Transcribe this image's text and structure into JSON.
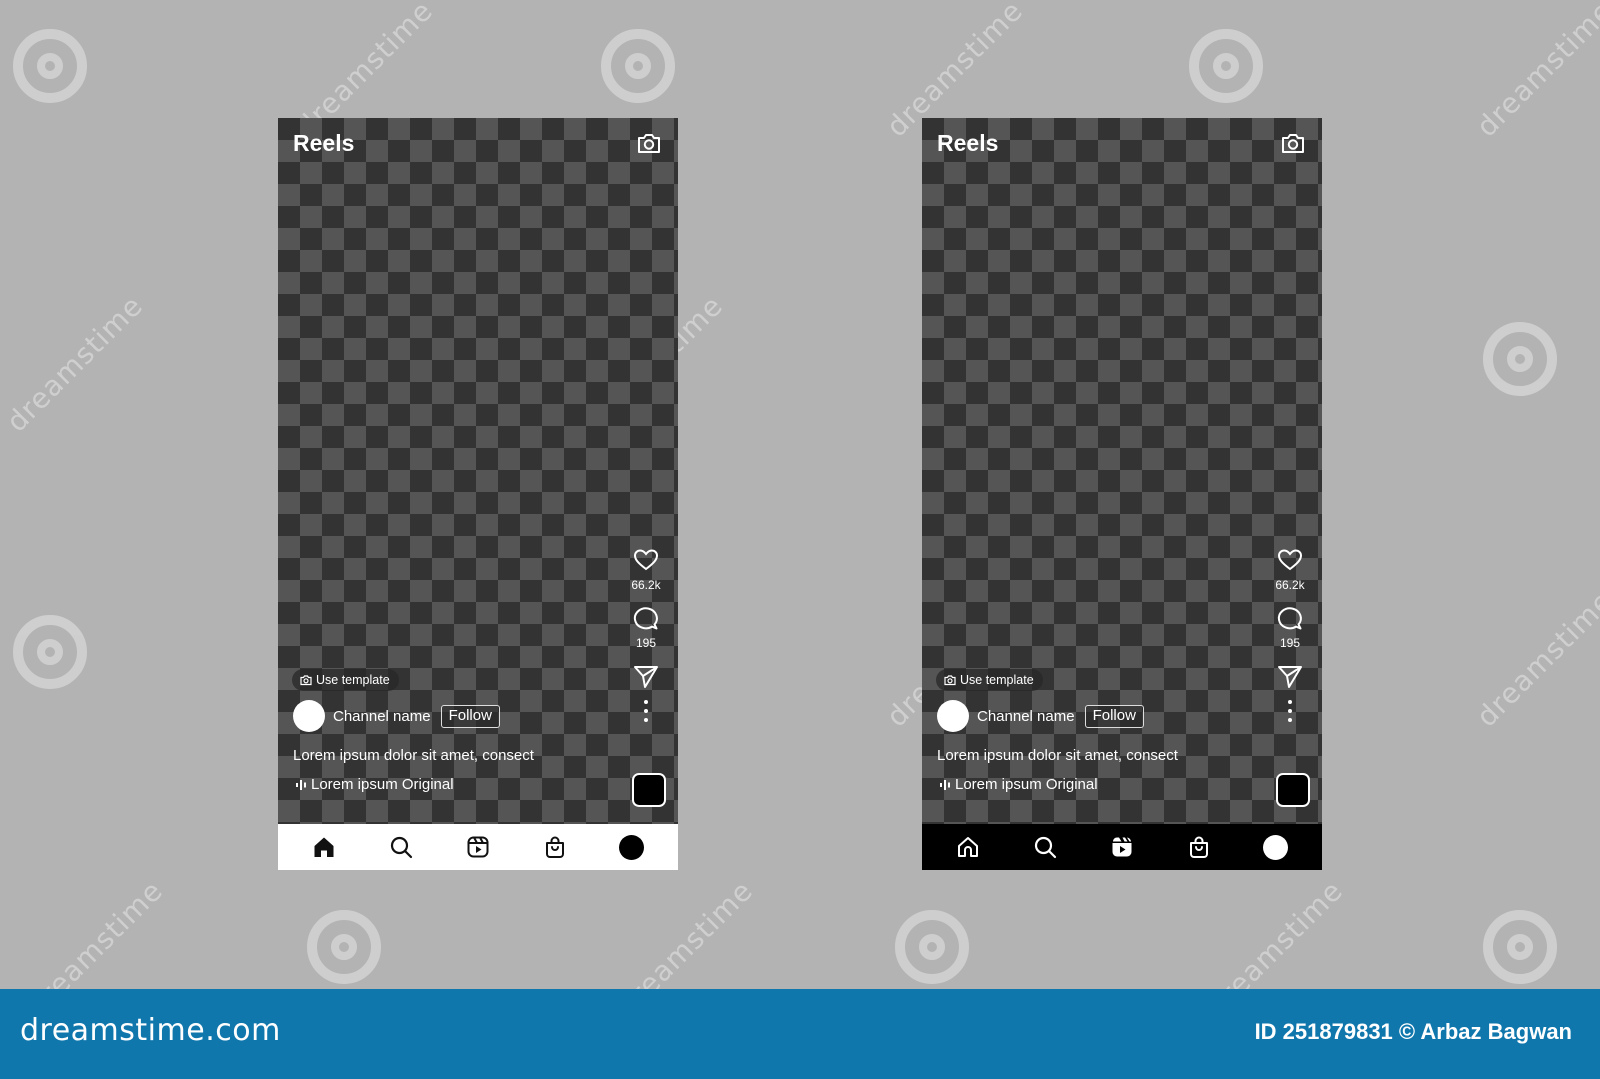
{
  "background": {
    "color": "#b3b3b3",
    "watermark_text": "dreamstime"
  },
  "screens": [
    {
      "variant": "light-nav",
      "title": "Reels",
      "header_icon": "camera-icon",
      "actions": {
        "like_icon": "heart-icon",
        "likes_count": "66.2k",
        "comment_icon": "comment-icon",
        "comments_count": "195",
        "share_icon": "send-icon",
        "more_icon": "more-vertical-icon"
      },
      "use_template_label": "Use template",
      "channel_name": "Channel name",
      "follow_label": "Follow",
      "caption": "Lorem ipsum dolor sit amet, consect",
      "audio_label": "Lorem ipsum Original",
      "nav": [
        "home-icon",
        "search-icon",
        "reels-icon",
        "shop-icon",
        "profile-avatar"
      ],
      "nav_background": "#ffffff"
    },
    {
      "variant": "dark-nav",
      "title": "Reels",
      "header_icon": "camera-icon",
      "actions": {
        "like_icon": "heart-icon",
        "likes_count": "66.2k",
        "comment_icon": "comment-icon",
        "comments_count": "195",
        "share_icon": "send-icon",
        "more_icon": "more-vertical-icon"
      },
      "use_template_label": "Use template",
      "channel_name": "Channel name",
      "follow_label": "Follow",
      "caption": "Lorem ipsum dolor sit amet, consect",
      "audio_label": "Lorem ipsum Original",
      "nav": [
        "home-icon",
        "search-icon",
        "reels-icon",
        "shop-icon",
        "profile-avatar"
      ],
      "nav_background": "#000000"
    }
  ],
  "footer": {
    "logo": "dreamstime.com",
    "credit": "ID 251879831 © Arbaz Bagwan",
    "background": "#1077ad"
  }
}
